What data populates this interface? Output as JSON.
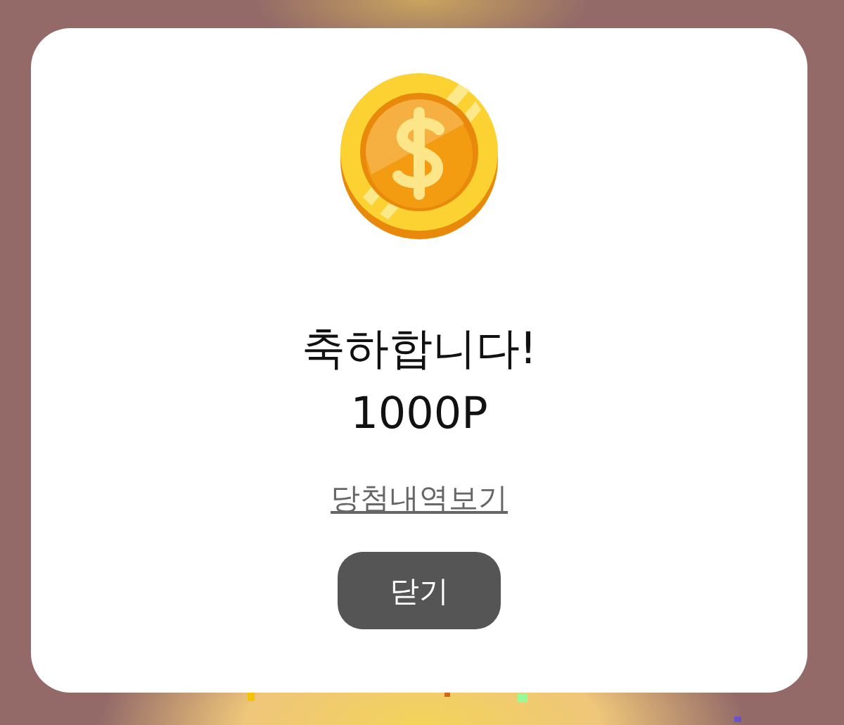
{
  "dialog": {
    "title": "축하합니다!",
    "amount": "1000P",
    "link": "당첨내역보기",
    "close_button": "닫기"
  }
}
